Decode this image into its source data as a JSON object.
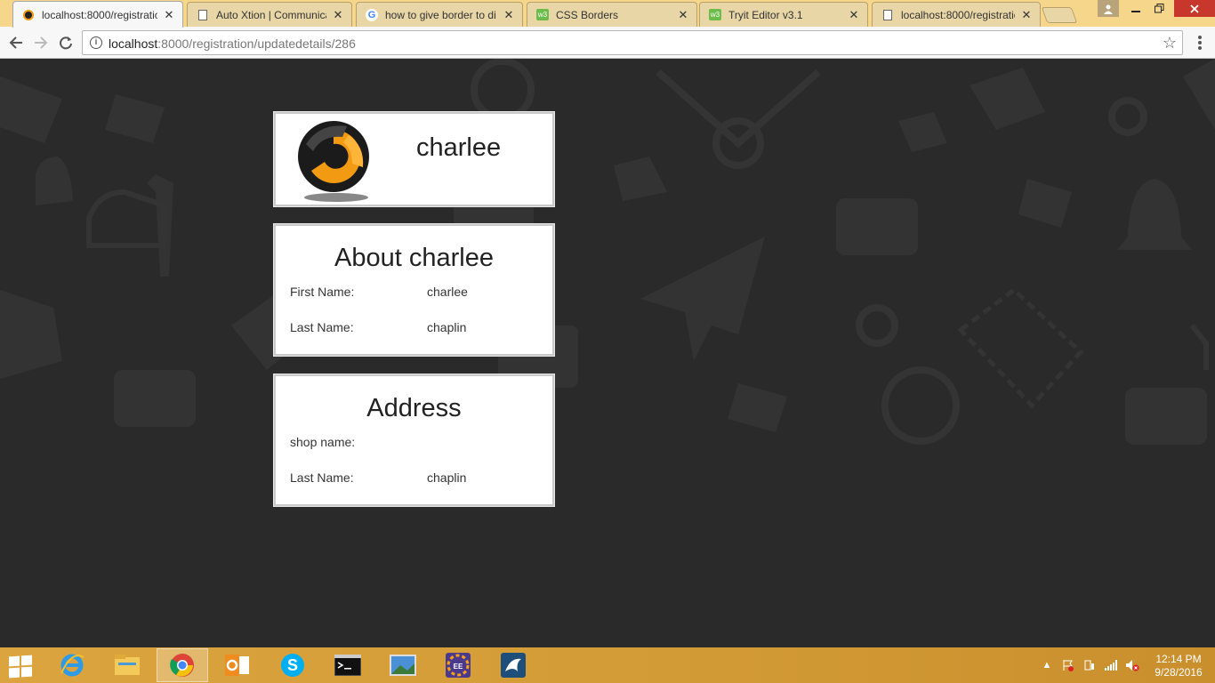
{
  "browser": {
    "tabs": [
      {
        "title": "localhost:8000/registratic",
        "icon": "site-logo-icon",
        "active": true
      },
      {
        "title": "Auto Xtion | Communicat",
        "icon": "document-icon",
        "active": false
      },
      {
        "title": "how to give border to di",
        "icon": "google-icon",
        "active": false
      },
      {
        "title": "CSS Borders",
        "icon": "w3schools-icon",
        "active": false
      },
      {
        "title": "Tryit Editor v3.1",
        "icon": "w3schools-icon",
        "active": false
      },
      {
        "title": "localhost:8000/registratic",
        "icon": "document-icon",
        "active": false
      }
    ],
    "tab_close": "✕",
    "url_host": "localhost",
    "url_path": ":8000/registration/updatedetails/286"
  },
  "profile": {
    "name": "charlee"
  },
  "about": {
    "heading": "About charlee",
    "rows": [
      {
        "label": "First Name:",
        "value": "charlee"
      },
      {
        "label": "Last Name:",
        "value": "chaplin"
      }
    ]
  },
  "address": {
    "heading": "Address",
    "rows": [
      {
        "label": "shop name:",
        "value": ""
      },
      {
        "label": "Last Name:",
        "value": "chaplin"
      }
    ]
  },
  "taskbar": {
    "apps": [
      "internet-explorer",
      "file-explorer",
      "chrome",
      "outlook",
      "skype",
      "command-prompt",
      "photos",
      "java-ee-ide",
      "mysql-workbench"
    ],
    "clock_time": "12:14 PM",
    "clock_date": "9/28/2016"
  },
  "colors": {
    "page_bg": "#2a2a2a",
    "tabstrip": "#f6d68a",
    "taskbar": "#d39b35",
    "accent_orange": "#f19a12"
  }
}
